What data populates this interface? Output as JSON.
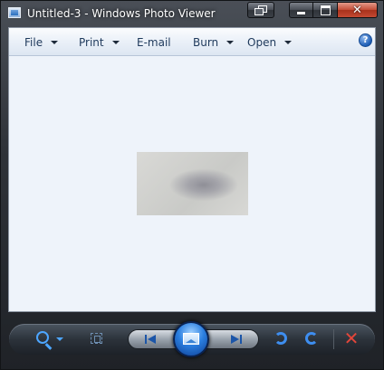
{
  "window": {
    "title": "Untitled-3 - Windows Photo Viewer",
    "icon": "photo-viewer-app-icon"
  },
  "controls": {
    "restore_tab_icon": "restore-window-icon",
    "minimize_icon": "minimize-icon",
    "maximize_icon": "maximize-icon",
    "close_icon": "close-icon",
    "close_glyph": "✕"
  },
  "menu": {
    "items": [
      {
        "label": "File",
        "has_dropdown": true
      },
      {
        "label": "Print",
        "has_dropdown": true
      },
      {
        "label": "E-mail",
        "has_dropdown": false
      },
      {
        "label": "Burn",
        "has_dropdown": true
      },
      {
        "label": "Open",
        "has_dropdown": true
      }
    ],
    "help_glyph": "?"
  },
  "toolbar": {
    "icons": [
      "zoom-icon",
      "actual-size-icon",
      "previous-icon",
      "slideshow-icon",
      "next-icon",
      "rotate-counterclockwise-icon",
      "rotate-clockwise-icon",
      "delete-icon"
    ],
    "delete_glyph": "✕"
  },
  "colors": {
    "accent": "#3e8ef0",
    "delete": "#e2463a",
    "menu_text": "#1e395b",
    "viewer_background": "#eef3fa"
  }
}
